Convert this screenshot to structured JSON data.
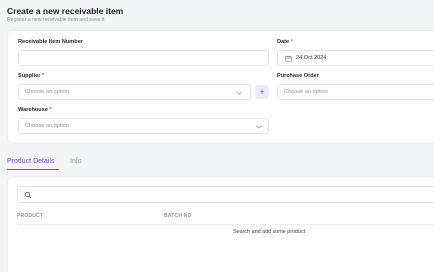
{
  "header": {
    "title": "Create a new receivable item",
    "subtitle": "Register a new receivable item and save it"
  },
  "form": {
    "receivable_item_number": {
      "label": "Receivable Item Number",
      "value": ""
    },
    "date": {
      "label": "Date",
      "required_mark": "*",
      "value": "24 Oct 2024",
      "icon": "calendar-icon"
    },
    "supplier": {
      "label": "Supplier",
      "required_mark": "*",
      "placeholder": "Choose an option",
      "icon": "chevron-down-icon"
    },
    "add_supplier": {
      "label": "+"
    },
    "purchase_order": {
      "label": "Purchase Order",
      "placeholder": "Choose an option"
    },
    "warehouse": {
      "label": "Warehouse",
      "required_mark": "*",
      "placeholder": "Choose an option",
      "icon": "chevron-down-icon"
    }
  },
  "tabs": [
    {
      "label": "Product Details",
      "active": true
    },
    {
      "label": "Info",
      "active": false
    }
  ],
  "products": {
    "search_icon": "search-icon",
    "columns": [
      "PRODUCT",
      "BATCH NO"
    ],
    "empty_message": "Search and add some product"
  },
  "colors": {
    "accent": "#7a45d6",
    "required": "#e0464a",
    "background": "#f4f5f7"
  }
}
